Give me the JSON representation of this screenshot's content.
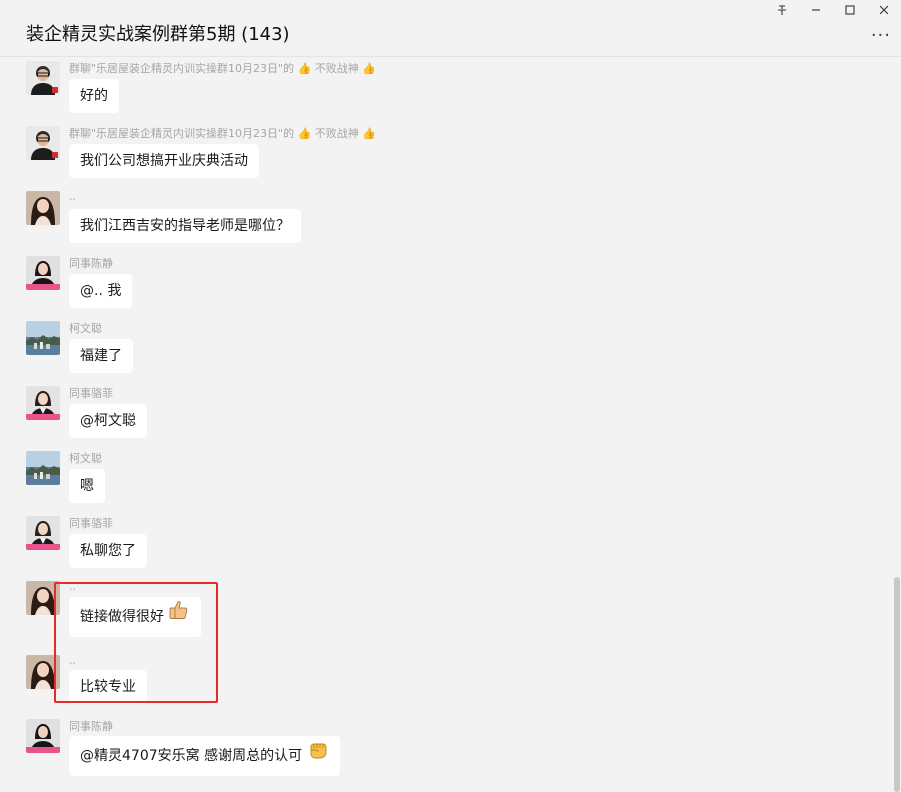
{
  "window": {
    "title": "装企精灵实战案例群第5期 (143)",
    "controls": {
      "pin": "pin-icon",
      "minimize": "minimize-icon",
      "maximize": "maximize-icon",
      "close": "close-icon"
    },
    "more_label": "..."
  },
  "messages": [
    {
      "sender": "群聊\"乐居屋装企精灵内训实操群10月23日\"的 👍 不败战神 👍",
      "text": "好的",
      "avatar": "man-glasses"
    },
    {
      "sender": "群聊\"乐居屋装企精灵内训实操群10月23日\"的 👍 不败战神 👍",
      "text": "我们公司想搞开业庆典活动",
      "avatar": "man-glasses"
    },
    {
      "sender": "..",
      "text": "我们江西吉安的指导老师是哪位？",
      "avatar": "woman-long-hair"
    },
    {
      "sender": "同事陈静",
      "text": "@.. 我",
      "avatar": "woman-suit"
    },
    {
      "sender": "柯文聪",
      "text": "福建了",
      "avatar": "city-landscape"
    },
    {
      "sender": "同事骆菲",
      "text": "@柯文聪",
      "avatar": "woman-suit-2"
    },
    {
      "sender": "柯文聪",
      "text": "嗯",
      "avatar": "city-landscape"
    },
    {
      "sender": "同事骆菲",
      "text": "私聊您了",
      "avatar": "woman-suit-2"
    },
    {
      "sender": "..",
      "text": "链接做得很好",
      "avatar": "woman-long-hair",
      "emoji": "thumbs-up-icon"
    },
    {
      "sender": "..",
      "text": "比较专业",
      "avatar": "woman-long-hair"
    },
    {
      "sender": "同事陈静",
      "text": "@精灵4707安乐窝 感谢周总的认可",
      "avatar": "woman-suit",
      "emoji": "fist-icon"
    }
  ],
  "colors": {
    "highlight": "#e52b2b",
    "bubble": "#ffffff",
    "background": "#f3f3f3"
  }
}
